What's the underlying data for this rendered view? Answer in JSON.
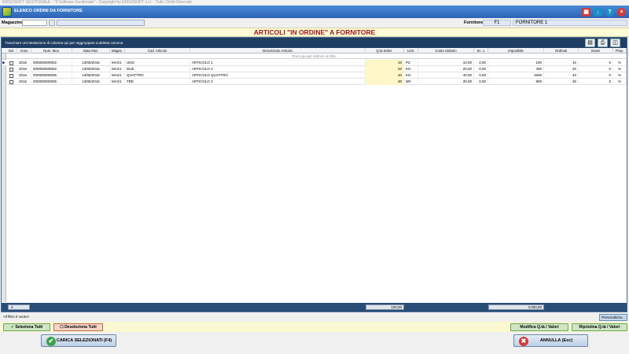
{
  "window": {
    "title": "ERGOSOFT GESTIONALE - \"Il Software Gestionale\" - Copyright by ERGOSOFT s.r.l. - Tutti i Diritti Riservati",
    "form_title": "ELENCO ORDINI DA FORNITORE"
  },
  "header_buttons": [
    "calc-icon",
    "download-icon",
    "help-icon",
    "close-icon"
  ],
  "filter": {
    "magazzino_label": "Magazzino",
    "magazzino_value": "",
    "fornitore_label": "Fornitore",
    "fornitore_code": "F1",
    "fornitore_name": "FORNITORE 1"
  },
  "banner": {
    "title": "ARTICOLI \"IN ORDINE\" A FORNITORE"
  },
  "grid": {
    "group_hint": "Trascinare un'intestazione di colonna qui per raggruppare suddetta colonna",
    "filter_hint": "Premi qui per definire un filtro",
    "columns": [
      "Sel.",
      "Anno",
      "Num. Mov.",
      "Data Mov.",
      "Magaz.",
      "Cod. Articolo",
      "Descrizione Articolo",
      "Q.tà Selez.",
      "U.M.",
      "Costo Unitario",
      "Sc. 1",
      "Imponibile",
      "Ordinati",
      "Evasi",
      "Prop."
    ],
    "rows": [
      {
        "anno": "2016",
        "num": "000000000002",
        "data": "13/05/2016",
        "mag": "MAG1",
        "cod": "UNO",
        "desc": "ARTICOLO 1",
        "qta": "10",
        "um": "PZ",
        "costo": "10,00",
        "sc": "0,00",
        "imp": "100",
        "ord": "10",
        "evasi": "0",
        "prop": "N"
      },
      {
        "anno": "2016",
        "num": "000000000002",
        "data": "13/05/2016",
        "mag": "MAG1",
        "cod": "DUE",
        "desc": "ARTICOLO 2",
        "qta": "20",
        "um": "KG",
        "costo": "20,00",
        "sc": "0,00",
        "imp": "400",
        "ord": "20",
        "evasi": "0",
        "prop": "N"
      },
      {
        "anno": "2016",
        "num": "000000000005",
        "data": "13/05/2016",
        "mag": "MAG1",
        "cod": "QUATTRO",
        "desc": "ARTICOLO QUATTRO",
        "qta": "40",
        "um": "KG",
        "costo": "40,00",
        "sc": "0,00",
        "imp": "1600",
        "ord": "40",
        "evasi": "0",
        "prop": "N"
      },
      {
        "anno": "2016",
        "num": "000000000005",
        "data": "13/05/2016",
        "mag": "MAG1",
        "cod": "TRE",
        "desc": "ARTICOLO 3",
        "qta": "30",
        "um": "NR",
        "costo": "30,00",
        "sc": "0,00",
        "imp": "900",
        "ord": "30",
        "evasi": "0",
        "prop": "N"
      }
    ],
    "footer": {
      "count": "4",
      "total_qta": "100,00",
      "total_imp": "3.000,00"
    }
  },
  "status": {
    "filter_text": "<Il filtro è vuoto>",
    "personalize_label": "Personalizza..."
  },
  "actions": {
    "select_all": "Seleziona Tutti",
    "deselect_all": "Deseleziona Tutti",
    "modify_qty": "Modifica Q.tà / Valori",
    "restore_qty": "Ripristina Q.tà / Valori"
  },
  "bottom": {
    "load_selected": "CARICA SELEZIONATI  (F4)",
    "cancel": "ANNULLA (Esc)"
  }
}
